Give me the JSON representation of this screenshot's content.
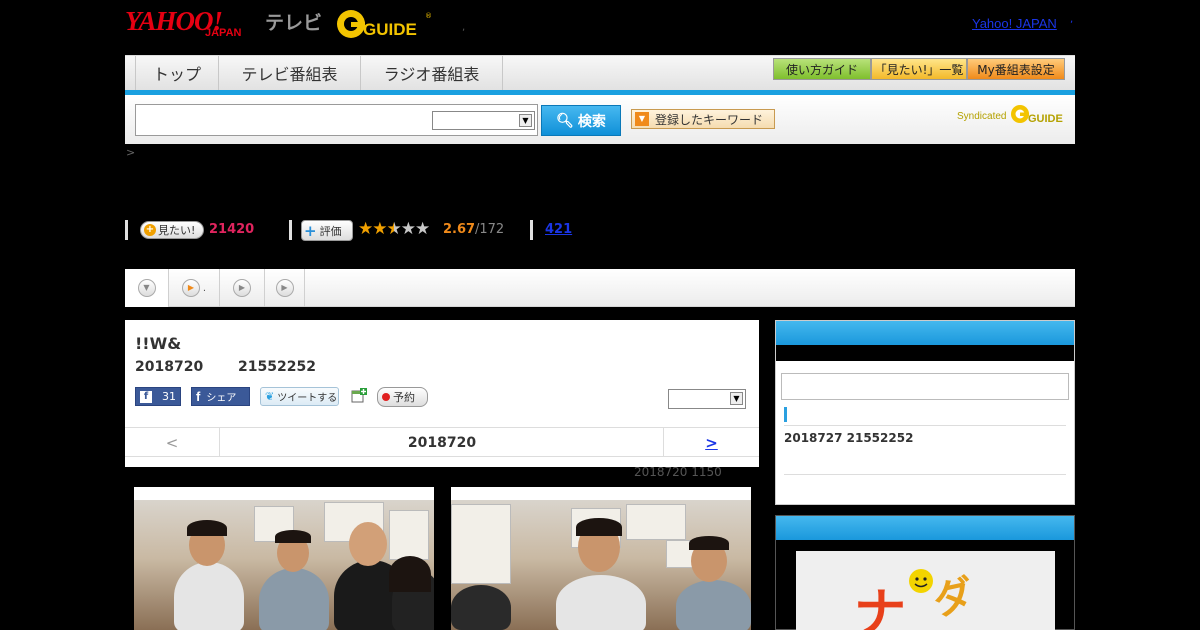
{
  "header": {
    "yahoo_logo": "YAHOO!",
    "japan_logo": "JAPAN",
    "tv_logo": "テレビ",
    "gguide_logo": "GUIDE",
    "yahoo_japan_link": "Yahoo! JAPAN"
  },
  "nav": {
    "tabs": [
      {
        "label": "トップ"
      },
      {
        "label": "テレビ番組表"
      },
      {
        "label": "ラジオ番組表"
      }
    ],
    "utility": [
      {
        "label": "使い方ガイド"
      },
      {
        "label": "「見たい!」一覧"
      },
      {
        "label": "My番組表設定"
      }
    ]
  },
  "search": {
    "value": "",
    "select_value": "",
    "button_label": "検索",
    "keyword_button_label": "登録したキーワード",
    "syndicated_label": "Syndicated",
    "syndicated_logo": "GUIDE"
  },
  "breadcrumb_mark": ">",
  "stats": {
    "mitai_label": "見たい!",
    "mitai_count": "21420",
    "hyoka_label": "評価",
    "rating_value": 2.67,
    "rating_text": "2.67",
    "rating_count": "/172",
    "link_count": "421"
  },
  "subtabs": {
    "second_label": "."
  },
  "program": {
    "title": "!!W&",
    "date": "2018720",
    "time": "21552252",
    "fb_like_count": "31",
    "fb_share_label": "シェア",
    "tweet_label": "ツイートする",
    "reserve_label": "予約",
    "select_value": "",
    "nav_prev": "<",
    "nav_date": "2018720",
    "nav_next": ">",
    "updated_note": "2018720  1150"
  },
  "sidebar": {
    "input_value": "",
    "item_text": "2018727  21552252"
  },
  "colors": {
    "accent_blue": "#1aa0e0",
    "yahoo_red": "#e60012",
    "mitai_pink": "#e0245e",
    "rating_orange": "#f08a1a",
    "link_blue": "#1a35e6"
  }
}
